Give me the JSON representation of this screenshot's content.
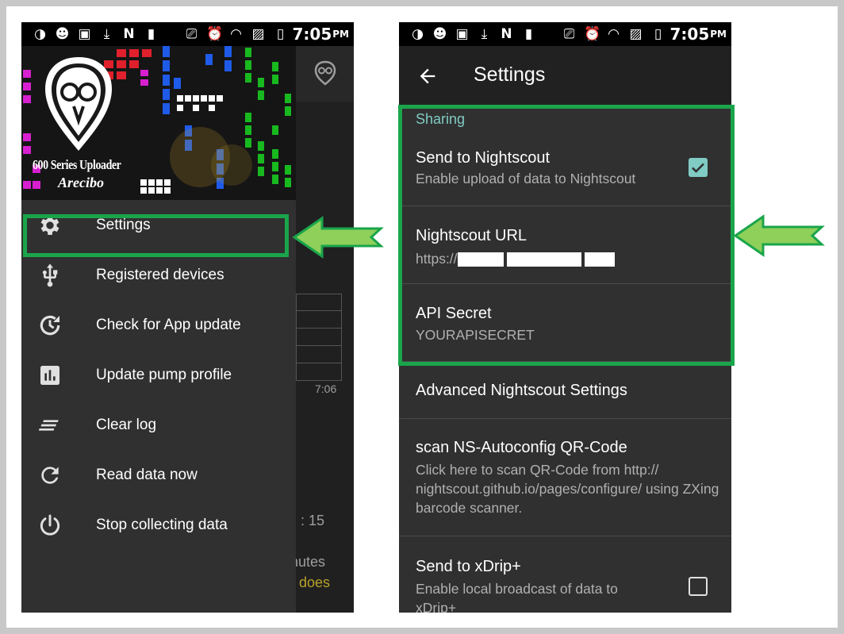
{
  "status_bar": {
    "time": "7:05",
    "ampm": "PM"
  },
  "left_screen": {
    "brand_title": "600 Series Uploader",
    "brand_subtitle": "Arecibo",
    "menu": [
      {
        "label": "Settings",
        "icon": "gear-icon"
      },
      {
        "label": "Registered devices",
        "icon": "usb-icon"
      },
      {
        "label": "Check for App update",
        "icon": "update-clock-icon"
      },
      {
        "label": "Update pump profile",
        "icon": "bar-chart-icon"
      },
      {
        "label": "Clear log",
        "icon": "clear-lines-icon"
      },
      {
        "label": "Read data now",
        "icon": "refresh-icon"
      },
      {
        "label": "Stop collecting data",
        "icon": "power-icon"
      }
    ],
    "background": {
      "chart_time": "7:06",
      "text_1": ": 15",
      "text_2": "inutes",
      "text_3": "e does"
    }
  },
  "right_screen": {
    "title": "Settings",
    "category": "Sharing",
    "prefs": [
      {
        "title": "Send to Nightscout",
        "summary": "Enable upload of data to Nightscout",
        "checked": true
      },
      {
        "title": "Nightscout URL",
        "summary": "https://"
      },
      {
        "title": "API Secret",
        "summary": "YOURAPISECRET"
      },
      {
        "title": "Advanced Nightscout Settings",
        "summary": ""
      },
      {
        "title": "scan NS-Autoconfig QR-Code",
        "summary": "Click here to scan QR-Code from http:// nightscout.github.io/pages/configure/ using ZXing barcode scanner."
      },
      {
        "title": "Send to xDrip+",
        "summary": "Enable local broadcast of data to xDrip+",
        "checked": false
      }
    ]
  },
  "colors": {
    "highlight": "#1aa54b",
    "arrow_fill": "#8ed05a",
    "accent": "#80cbc4"
  }
}
